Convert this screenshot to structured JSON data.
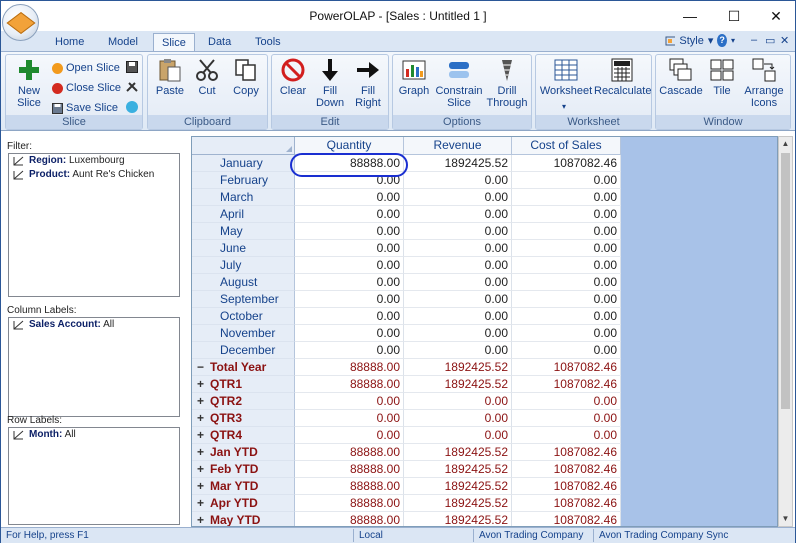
{
  "window": {
    "title": "PowerOLAP - [Sales : Untitled 1 ]"
  },
  "window_controls": {
    "minimize": "—",
    "maximize": "☐",
    "close": "✕"
  },
  "tabs": [
    {
      "label": "Home",
      "active": false
    },
    {
      "label": "Model",
      "active": false
    },
    {
      "label": "Slice",
      "active": true
    },
    {
      "label": "Data",
      "active": false
    },
    {
      "label": "Tools",
      "active": false
    }
  ],
  "style_menu": {
    "label": "Style",
    "arrow": "▾",
    "help": "?"
  },
  "mini_controls": {
    "minimize": "‒",
    "restore": "▭",
    "close": "✕"
  },
  "ribbon": {
    "slice": {
      "label": "Slice",
      "new_slice": "New Slice",
      "open_slice": "Open Slice",
      "close_slice": "Close Slice",
      "save_slice": "Save Slice"
    },
    "clipboard": {
      "label": "Clipboard",
      "paste": "Paste",
      "cut": "Cut",
      "copy": "Copy"
    },
    "edit": {
      "label": "Edit",
      "clear": "Clear",
      "fill_down": "Fill Down",
      "fill_right": "Fill Right"
    },
    "options": {
      "label": "Options",
      "graph": "Graph",
      "constrain_slice": "Constrain Slice",
      "drill_through": "Drill Through"
    },
    "worksheet": {
      "label": "Worksheet",
      "worksheet": "Worksheet",
      "recalculate": "Recalculate"
    },
    "window": {
      "label": "Window",
      "cascade": "Cascade",
      "tile": "Tile",
      "arrange_icons": "Arrange Icons"
    }
  },
  "filter_panel": {
    "title": "Filter:",
    "items": [
      {
        "key": "Region:",
        "value": "Luxembourg"
      },
      {
        "key": "Product:",
        "value": "Aunt Re's Chicken"
      }
    ]
  },
  "column_panel": {
    "title": "Column Labels:",
    "items": [
      {
        "key": "Sales Account:",
        "value": "All"
      }
    ]
  },
  "row_panel": {
    "title": "Row Labels:",
    "items": [
      {
        "key": "Month:",
        "value": "All"
      }
    ]
  },
  "grid": {
    "columns": [
      "Quantity",
      "Revenue",
      "Cost of Sales"
    ],
    "rows": [
      {
        "label": "January",
        "values": [
          "88888.00",
          "1892425.52",
          "1087082.46"
        ],
        "level": "month"
      },
      {
        "label": "February",
        "values": [
          "0.00",
          "0.00",
          "0.00"
        ],
        "level": "month"
      },
      {
        "label": "March",
        "values": [
          "0.00",
          "0.00",
          "0.00"
        ],
        "level": "month"
      },
      {
        "label": "April",
        "values": [
          "0.00",
          "0.00",
          "0.00"
        ],
        "level": "month"
      },
      {
        "label": "May",
        "values": [
          "0.00",
          "0.00",
          "0.00"
        ],
        "level": "month"
      },
      {
        "label": "June",
        "values": [
          "0.00",
          "0.00",
          "0.00"
        ],
        "level": "month"
      },
      {
        "label": "July",
        "values": [
          "0.00",
          "0.00",
          "0.00"
        ],
        "level": "month"
      },
      {
        "label": "August",
        "values": [
          "0.00",
          "0.00",
          "0.00"
        ],
        "level": "month"
      },
      {
        "label": "September",
        "values": [
          "0.00",
          "0.00",
          "0.00"
        ],
        "level": "month"
      },
      {
        "label": "October",
        "values": [
          "0.00",
          "0.00",
          "0.00"
        ],
        "level": "month"
      },
      {
        "label": "November",
        "values": [
          "0.00",
          "0.00",
          "0.00"
        ],
        "level": "month"
      },
      {
        "label": "December",
        "values": [
          "0.00",
          "0.00",
          "0.00"
        ],
        "level": "month"
      },
      {
        "label": "Total Year",
        "values": [
          "88888.00",
          "1892425.52",
          "1087082.46"
        ],
        "level": "total",
        "toggle": "−"
      },
      {
        "label": "QTR1",
        "values": [
          "88888.00",
          "1892425.52",
          "1087082.46"
        ],
        "level": "group",
        "toggle": "+"
      },
      {
        "label": "QTR2",
        "values": [
          "0.00",
          "0.00",
          "0.00"
        ],
        "level": "group",
        "toggle": "+"
      },
      {
        "label": "QTR3",
        "values": [
          "0.00",
          "0.00",
          "0.00"
        ],
        "level": "group",
        "toggle": "+"
      },
      {
        "label": "QTR4",
        "values": [
          "0.00",
          "0.00",
          "0.00"
        ],
        "level": "group",
        "toggle": "+"
      },
      {
        "label": "Jan YTD",
        "values": [
          "88888.00",
          "1892425.52",
          "1087082.46"
        ],
        "level": "group",
        "toggle": "+"
      },
      {
        "label": "Feb YTD",
        "values": [
          "88888.00",
          "1892425.52",
          "1087082.46"
        ],
        "level": "group",
        "toggle": "+"
      },
      {
        "label": "Mar YTD",
        "values": [
          "88888.00",
          "1892425.52",
          "1087082.46"
        ],
        "level": "group",
        "toggle": "+"
      },
      {
        "label": "Apr YTD",
        "values": [
          "88888.00",
          "1892425.52",
          "1087082.46"
        ],
        "level": "group",
        "toggle": "+"
      },
      {
        "label": "May YTD",
        "values": [
          "88888.00",
          "1892425.52",
          "1087082.46"
        ],
        "level": "group",
        "toggle": "+"
      }
    ]
  },
  "scrollbar": {
    "up": "▲",
    "down": "▼"
  },
  "status_bar": {
    "help": "For Help, press F1",
    "mode": "Local",
    "server": "Avon Trading Company",
    "sync": "Avon Trading Company Sync"
  }
}
